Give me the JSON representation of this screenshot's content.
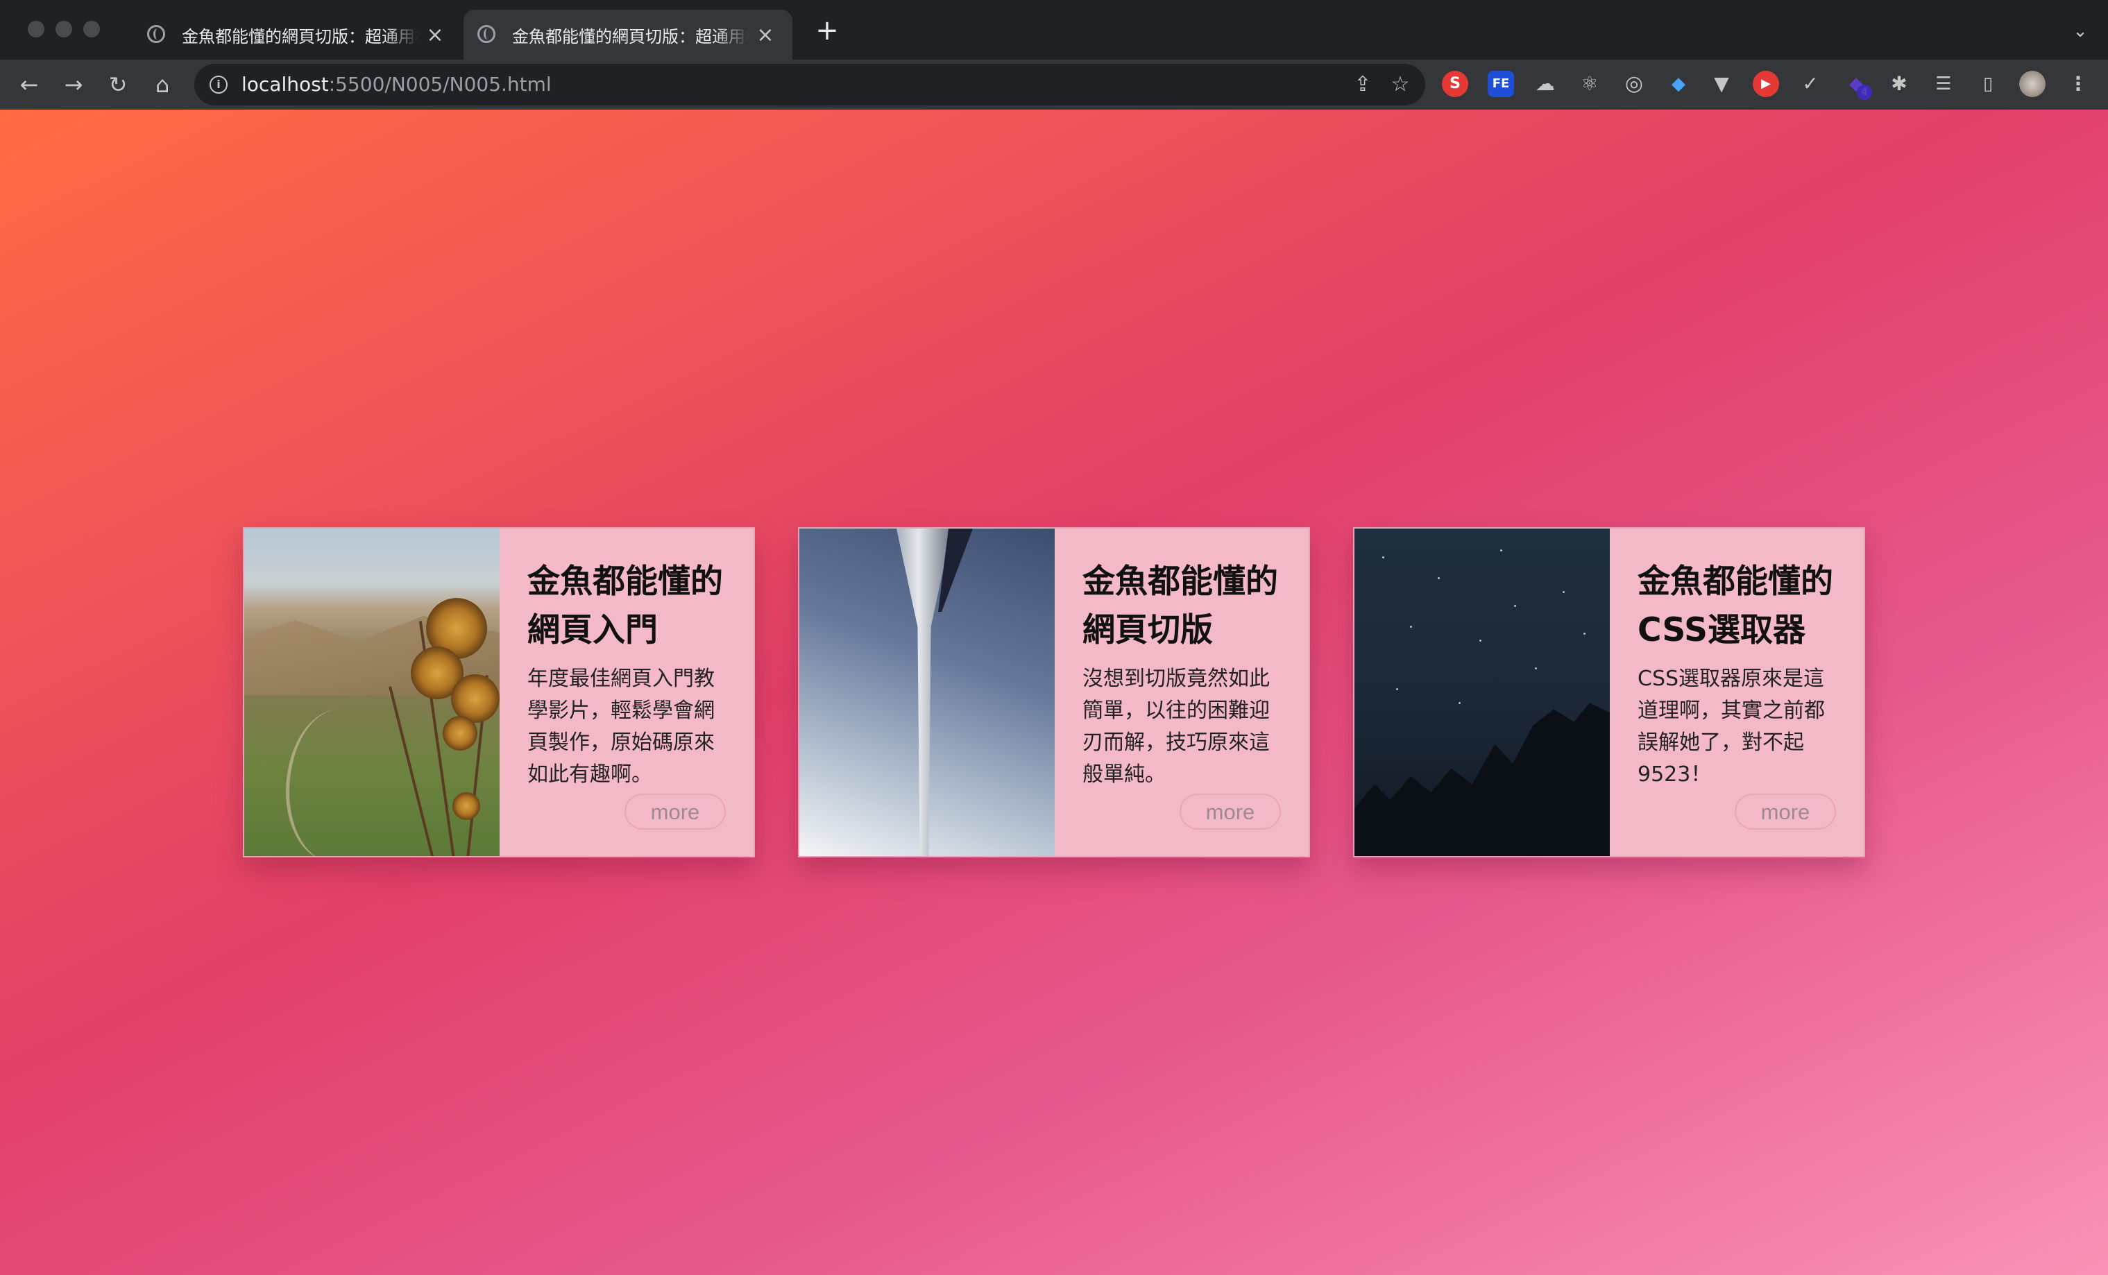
{
  "browser": {
    "tabs": [
      {
        "title": "金魚都能懂的網頁切版：超通用標"
      },
      {
        "title": "金魚都能懂的網頁切版：超通用標"
      }
    ],
    "url_host": "localhost",
    "url_path": ":5500/N005/N005.html",
    "extension_badge": "4"
  },
  "cards": [
    {
      "title_line1": "金魚都能懂的",
      "title_line2": "網頁入門",
      "text": "年度最佳網頁入門教學影片，輕鬆學會網頁製作，原始碼原來如此有趣啊。",
      "button": "more",
      "photo": "thistle-mountain-photo"
    },
    {
      "title_line1": "金魚都能懂的",
      "title_line2": "網頁切版",
      "text": "沒想到切版竟然如此簡單，以往的困難迎刃而解，技巧原來這般單純。",
      "button": "more",
      "photo": "arch-sky-photo"
    },
    {
      "title_line1": "金魚都能懂的",
      "title_line2": "CSS選取器",
      "text": "CSS選取器原來是這道理啊，其實之前都誤解她了，對不起9523！",
      "button": "more",
      "photo": "night-sky-photo"
    }
  ],
  "colors": {
    "gradient_start": "#ff6c44",
    "gradient_mid": "#e24068",
    "gradient_end": "#f992b6",
    "card_bg": "#f4b9c7"
  }
}
